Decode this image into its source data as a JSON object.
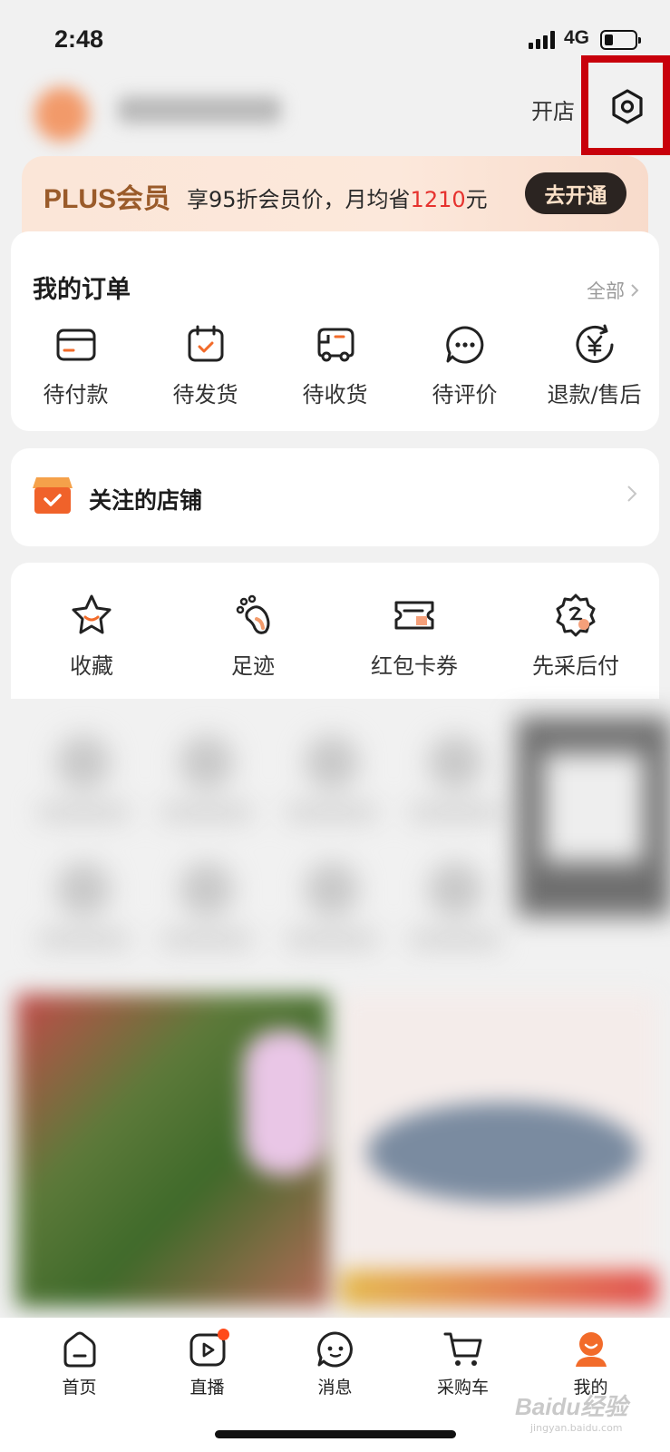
{
  "status_bar": {
    "time": "2:48",
    "network": "4G",
    "battery_level": 0.25
  },
  "header": {
    "open_store_label": "开店",
    "settings_icon": "settings-hexagon-icon"
  },
  "plus_banner": {
    "title": "PLUS会员",
    "desc_prefix": "享95折会员价，月均省",
    "amount": "1210",
    "desc_suffix": "元",
    "button_label": "去开通"
  },
  "orders": {
    "title": "我的订单",
    "all_label": "全部",
    "items": [
      {
        "label": "待付款",
        "icon": "wallet-icon"
      },
      {
        "label": "待发货",
        "icon": "box-icon"
      },
      {
        "label": "待收货",
        "icon": "truck-icon"
      },
      {
        "label": "待评价",
        "icon": "chat-icon"
      },
      {
        "label": "退款/售后",
        "icon": "refund-icon"
      }
    ]
  },
  "followed_stores": {
    "label": "关注的店铺"
  },
  "quick_links": [
    {
      "label": "收藏",
      "icon": "star-icon"
    },
    {
      "label": "足迹",
      "icon": "footprint-icon"
    },
    {
      "label": "红包卡券",
      "icon": "coupon-icon"
    },
    {
      "label": "先采后付",
      "icon": "pay-later-icon"
    }
  ],
  "tab_bar": [
    {
      "label": "首页",
      "icon": "home-icon"
    },
    {
      "label": "直播",
      "icon": "live-icon",
      "badge": true
    },
    {
      "label": "消息",
      "icon": "message-icon"
    },
    {
      "label": "采购车",
      "icon": "cart-icon"
    },
    {
      "label": "我的",
      "icon": "profile-icon",
      "active": true
    }
  ],
  "watermark": {
    "text": "Baidu经验",
    "sub": "jingyan.baidu.com"
  },
  "colors": {
    "accent_red": "#e6322e",
    "plus_brown": "#9a5b2a",
    "highlight_red": "#c8000b",
    "orange": "#f26b2a"
  }
}
